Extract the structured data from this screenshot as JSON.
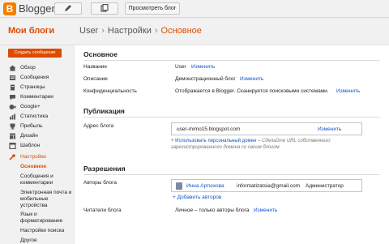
{
  "topbar": {
    "logo_letter": "B",
    "brand": "Blogger",
    "view_blog": "Просмотреть блог",
    "icons": [
      "pencil-icon",
      "copy-icon"
    ]
  },
  "header": {
    "my_blogs": "Мои блоги",
    "breadcrumb": [
      "User",
      "Настройки",
      "Основное"
    ],
    "separator": "›"
  },
  "sidebar": {
    "new_post": "Создать сообщение",
    "items": [
      {
        "label": "Обзор",
        "icon": "home-icon"
      },
      {
        "label": "Сообщения",
        "icon": "posts-icon"
      },
      {
        "label": "Страницы",
        "icon": "pages-icon"
      },
      {
        "label": "Комментарии",
        "icon": "comments-icon"
      },
      {
        "label": "Google+",
        "icon": "google-plus-icon"
      },
      {
        "label": "Статистика",
        "icon": "stats-icon"
      },
      {
        "label": "Прибыль",
        "icon": "earnings-icon"
      },
      {
        "label": "Дизайн",
        "icon": "layout-icon"
      },
      {
        "label": "Шаблон",
        "icon": "template-icon"
      },
      {
        "label": "Настройки",
        "icon": "wrench-icon"
      }
    ],
    "subitems": [
      "Основное",
      "Сообщения и комментарии",
      "Электронная почта и мобильные устройства",
      "Язык и форматирование",
      "Настройки поиска",
      "Другое"
    ]
  },
  "main": {
    "basic": {
      "title": "Основное",
      "name_label": "Название",
      "name_value": "User",
      "description_label": "Описание",
      "description_value": "Демонстрационный блог",
      "privacy_label": "Конфиденциальность",
      "privacy_value": "Отображается в Blogger. Сканируется поисковыми системами.",
      "edit": "Изменить"
    },
    "publishing": {
      "title": "Публикация",
      "address_label": "Адрес блога",
      "address_value": "user-mimo15.blogspot.com",
      "edit": "Изменить",
      "custom_domain_link": "+ Использовать персональный домен",
      "custom_domain_note": " – Сделайте URL собственного зарегистрированного домена со своим блогом."
    },
    "permissions": {
      "title": "Разрешения",
      "authors_label": "Авторы блога",
      "author_name": "Инна Артюхова",
      "author_email": "informatizatsia@gmail.com",
      "author_role": "Администратор",
      "add_authors": "+ Добавить авторов",
      "readers_label": "Читатели блога",
      "readers_value": "Личное – только авторы блога",
      "edit": "Изменить"
    }
  },
  "colors": {
    "accent": "#dd4b00",
    "link": "#1155cc",
    "sidebar_bg": "#f1f1f1"
  }
}
